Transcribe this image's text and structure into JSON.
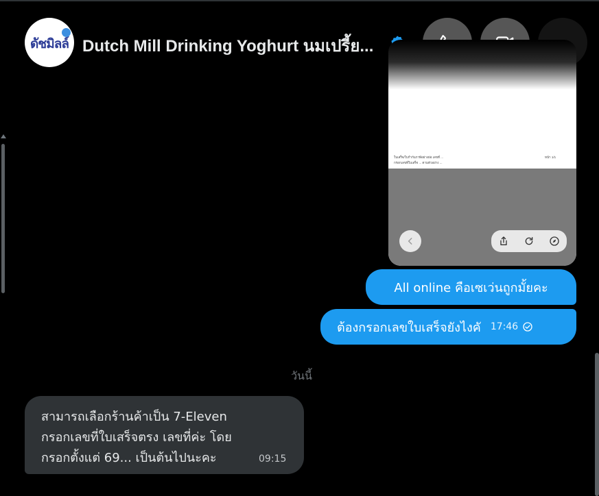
{
  "header": {
    "avatar_text": "ดัชมิลล์",
    "title": "Dutch Mill Drinking Yoghurt นมเปรี้ย...",
    "verified_icon": "verified-badge-icon",
    "buttons": {
      "call": "phone-icon",
      "video": "video-camera-icon",
      "more": "more-dots-icon"
    }
  },
  "image_message": {
    "doc_line1": "ใบเสร็จ/ใบกำกับภาษีอย่างย่อ เลขที่ ...",
    "doc_line1_right": "หน้า 1/1",
    "doc_line2": "กรอกเลขที่ใบเสร็จ ... ตามตัวอย่าง ...",
    "controls": [
      "back-icon",
      "share-icon",
      "refresh-icon",
      "compass-icon"
    ]
  },
  "messages": {
    "out1": "All online คือเซเว่นถูกมั้ยคะ",
    "out2": "ต้องกรอกเลขใบเสร็จยังไงคั",
    "out2_time": "17:46",
    "day_separator": "วันนี้",
    "in1_lines": [
      "สามารถเลือกร้านค้าเป็น 7-Eleven",
      "กรอกเลขที่ใบเสร็จตรง เลขที่ค่ะ โดย",
      "กรอกตั้งแต่ 69... เป็นต้นไปนะคะ"
    ],
    "in1_time": "09:15"
  },
  "colors": {
    "background": "#000000",
    "outgoing_bubble": "#1d9bf0",
    "incoming_bubble": "#2f3336",
    "text": "#e7e9ea",
    "muted": "#71767b"
  }
}
